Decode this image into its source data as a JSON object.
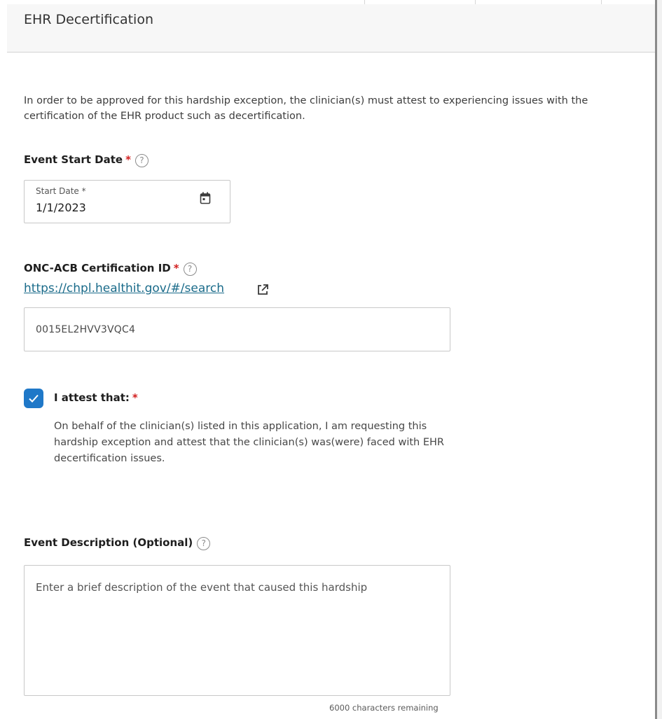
{
  "header": {
    "title": "EHR Decertification"
  },
  "intro_text": "In order to be approved for this hardship exception, the clinician(s) must attest to experiencing issues with the certification of the EHR product such as decertification.",
  "event_start_date": {
    "label": "Event Start Date",
    "required_mark": "*",
    "help_icon": "question-circle-icon",
    "field_label": "Start Date *",
    "value": "1/1/2023",
    "icon": "calendar-icon"
  },
  "certification": {
    "label": "ONC-ACB Certification ID",
    "required_mark": "*",
    "help_icon": "question-circle-icon",
    "link_text": "https://chpl.healthit.gov/#/search",
    "link_icon": "external-link-icon",
    "value": "0015EL2HVV3VQC4"
  },
  "attestation": {
    "checked": true,
    "label": "I attest that:",
    "required_mark": "*",
    "text": "On behalf of the clinician(s) listed in this application, I am requesting this hardship exception and attest that the clinician(s) was(were) faced with EHR decertification issues."
  },
  "event_description": {
    "label": "Event Description (Optional)",
    "help_icon": "question-circle-icon",
    "placeholder": "Enter a brief description of the event that caused this hardship",
    "remaining": "6000 characters remaining"
  },
  "colors": {
    "accent": "#1f78c8",
    "required": "#d21f1f",
    "link": "#1a6b8a"
  }
}
